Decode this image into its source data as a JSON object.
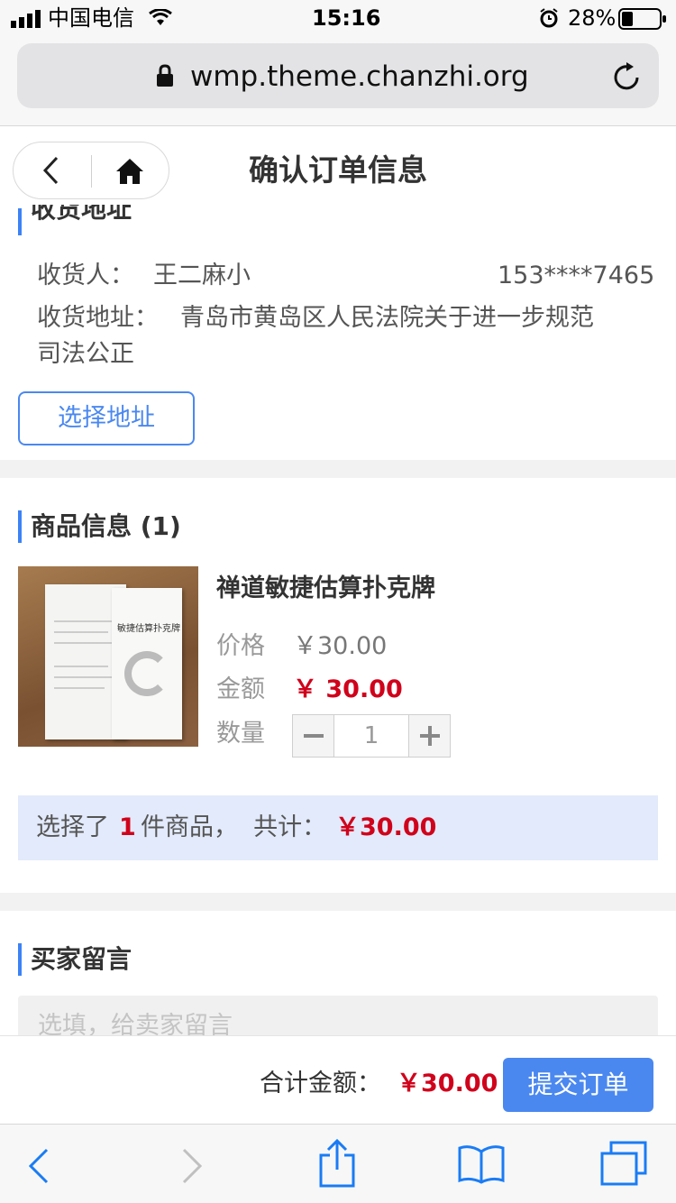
{
  "status_bar": {
    "carrier": "中国电信",
    "time": "15:16",
    "battery": "28%"
  },
  "browser": {
    "url": "wmp.theme.chanzhi.org"
  },
  "header": {
    "title": "确认订单信息"
  },
  "address": {
    "section_title": "收货地址",
    "receiver_label": "收货人：",
    "receiver_name": "王二麻小",
    "phone": "153****7465",
    "address_label": "收货地址：",
    "address_line1": "青岛市黄岛区人民法院关于进一步规范",
    "address_line2": "司法公正",
    "select_button": "选择地址"
  },
  "goods": {
    "section_title": "商品信息 (1)",
    "item": {
      "name": "禅道敏捷估算扑克牌",
      "price_label": "价格",
      "price": "￥30.00",
      "amount_label": "金额",
      "amount": "￥ 30.00",
      "qty_label": "数量",
      "qty": "1",
      "image_box_text": "敏捷估算扑克牌"
    },
    "summary_prefix": "选择了",
    "summary_count": "1",
    "summary_mid": "件商品，  共计：",
    "summary_total": "￥30.00"
  },
  "message": {
    "section_title": "买家留言",
    "placeholder": "选填，给卖家留言"
  },
  "footer": {
    "total_label": "合计金额：",
    "total_value": "￥30.00",
    "submit": "提交订单"
  },
  "colors": {
    "accent": "#4a88f0",
    "price": "#d0021b",
    "summary_bg": "#e2eafb"
  },
  "icons": [
    "signal-icon",
    "wifi-icon",
    "alarm-icon",
    "battery-icon",
    "lock-icon",
    "reload-icon",
    "back-icon",
    "home-icon",
    "minus-icon",
    "plus-icon",
    "browser-back-icon",
    "browser-forward-icon",
    "share-icon",
    "bookmarks-icon",
    "tabs-icon"
  ]
}
